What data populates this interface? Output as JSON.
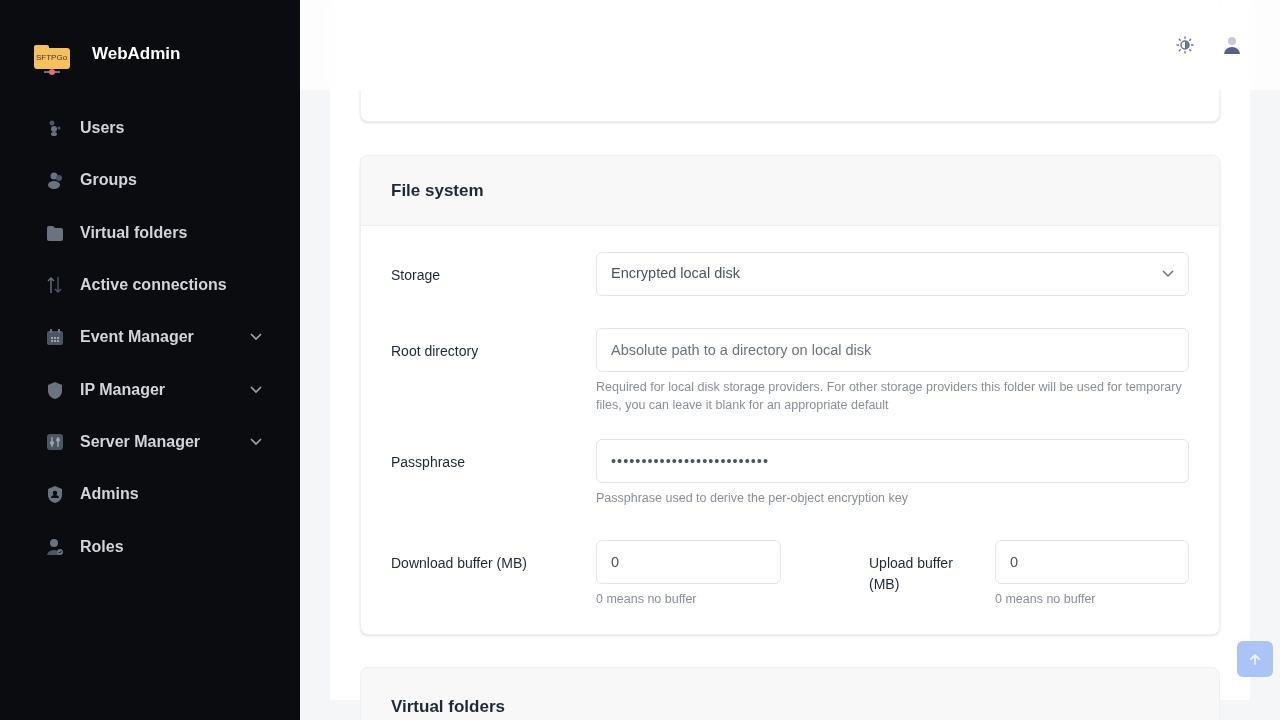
{
  "brand": {
    "logo_text": "SFTPGo",
    "title": "WebAdmin"
  },
  "sidebar": {
    "items": [
      {
        "label": "Users",
        "expandable": false
      },
      {
        "label": "Groups",
        "expandable": false
      },
      {
        "label": "Virtual folders",
        "expandable": false
      },
      {
        "label": "Active connections",
        "expandable": false
      },
      {
        "label": "Event Manager",
        "expandable": true
      },
      {
        "label": "IP Manager",
        "expandable": true
      },
      {
        "label": "Server Manager",
        "expandable": true
      },
      {
        "label": "Admins",
        "expandable": false
      },
      {
        "label": "Roles",
        "expandable": false
      }
    ]
  },
  "file_system": {
    "title": "File system",
    "storage": {
      "label": "Storage",
      "value": "Encrypted local disk"
    },
    "root_directory": {
      "label": "Root directory",
      "placeholder": "Absolute path to a directory on local disk",
      "help": "Required for local disk storage providers. For other storage providers this folder will be used for temporary files, you can leave it blank for an appropriate default"
    },
    "passphrase": {
      "label": "Passphrase",
      "value": "••••••••••••••••••••••••••",
      "help": "Passphrase used to derive the per-object encryption key"
    },
    "download_buffer": {
      "label": "Download buffer (MB)",
      "value": "0",
      "help": "0 means no buffer"
    },
    "upload_buffer": {
      "label": "Upload buffer (MB)",
      "value": "0",
      "help": "0 means no buffer"
    }
  },
  "next_section": {
    "title": "Virtual folders"
  }
}
